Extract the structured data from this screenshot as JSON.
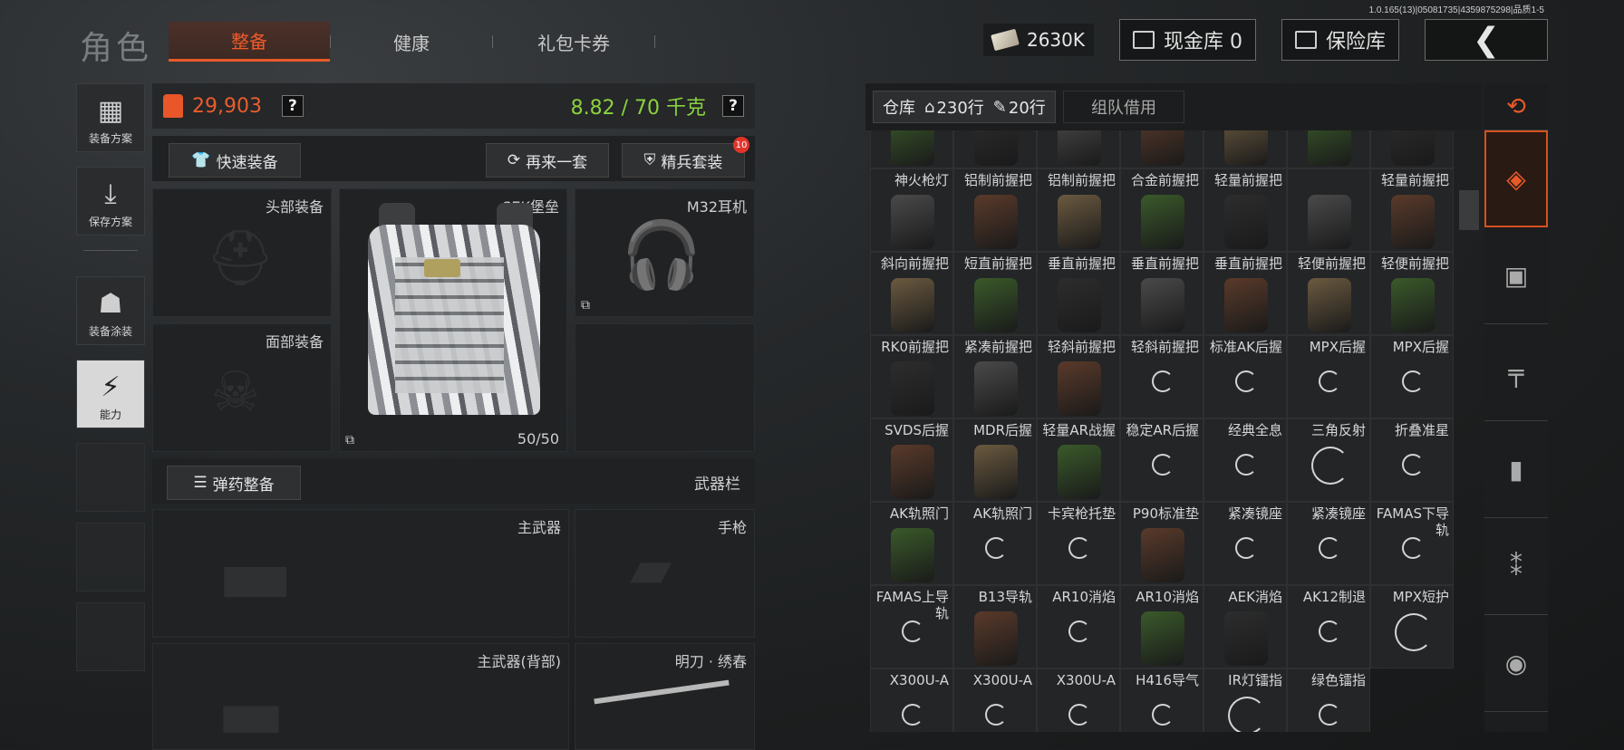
{
  "version": "1.0.165(13)|05081735|4359875298|品质1-5",
  "header": {
    "title": "角色",
    "tabs": [
      {
        "label": "整备",
        "active": true
      },
      {
        "label": "健康",
        "active": false
      },
      {
        "label": "礼包卡券",
        "active": false
      }
    ],
    "cash": "2630K",
    "cash_vault": "现金库 0",
    "safe": "保险库",
    "back_icon": "chevron-left-icon"
  },
  "sidenav": [
    {
      "label": "装备方案",
      "icon": "vest-plan-icon"
    },
    {
      "label": "保存方案",
      "icon": "download-icon"
    },
    {
      "label": "装备涂装",
      "icon": "helmet-paint-icon"
    },
    {
      "label": "能力",
      "icon": "ability-icon"
    }
  ],
  "stats": {
    "value": "29,903",
    "weight": "8.82 / 70 千克",
    "help": "?"
  },
  "actions": {
    "quick_equip": "快速装备",
    "again": "再来一套",
    "elite_kit": "精兵套装",
    "elite_badge": "10",
    "ammo_equip": "弹药整备",
    "weapon_bar": "武器栏"
  },
  "slots": {
    "head": "头部装备",
    "face": "面部装备",
    "vest": "SEK堡垒",
    "vest_durability": "50/50",
    "earphone": "M32耳机",
    "primary": "主武器",
    "pistol": "手枪",
    "primary_back": "主武器(背部)",
    "melee": "明刀 · 绣春"
  },
  "inventory": {
    "tab_warehouse": "仓库",
    "rows_1": "230行",
    "rows_2": "20行",
    "tab_team": "组队借用",
    "items": [
      "",
      "",
      "",
      "",
      "",
      "",
      "",
      "神火枪灯",
      "铝制前握把",
      "铝制前握把",
      "合金前握把",
      "轻量前握把",
      "",
      "轻量前握把",
      "斜向前握把",
      "短直前握把",
      "垂直前握把",
      "垂直前握把",
      "垂直前握把",
      "轻便前握把",
      "轻便前握把",
      "RK0前握把",
      "紧凑前握把",
      "轻斜前握把",
      "轻斜前握把",
      "标准AK后握",
      "MPX后握",
      "MPX后握",
      "SVDS后握",
      "MDR后握",
      "轻量AR战握",
      "稳定AR后握",
      "经典全息",
      "三角反射",
      "折叠准星",
      "AK轨照门",
      "AK轨照门",
      "卡宾枪托垫",
      "P90标准垫",
      "紧凑镜座",
      "紧凑镜座",
      "FAMAS下导轨",
      "FAMAS上导轨",
      "B13导轨",
      "AR10消焰",
      "AR10消焰",
      "AEK消焰",
      "AK12制退",
      "MPX短护",
      "X300U-A",
      "X300U-A",
      "X300U-A",
      "H416导气",
      "IR灯镭指",
      "绿色镭指"
    ]
  },
  "categories": [
    "stack-refresh-icon",
    "stack-icon",
    "vest-icon",
    "rifle-icon",
    "magazine-icon",
    "bullet-icon",
    "sight-icon"
  ]
}
